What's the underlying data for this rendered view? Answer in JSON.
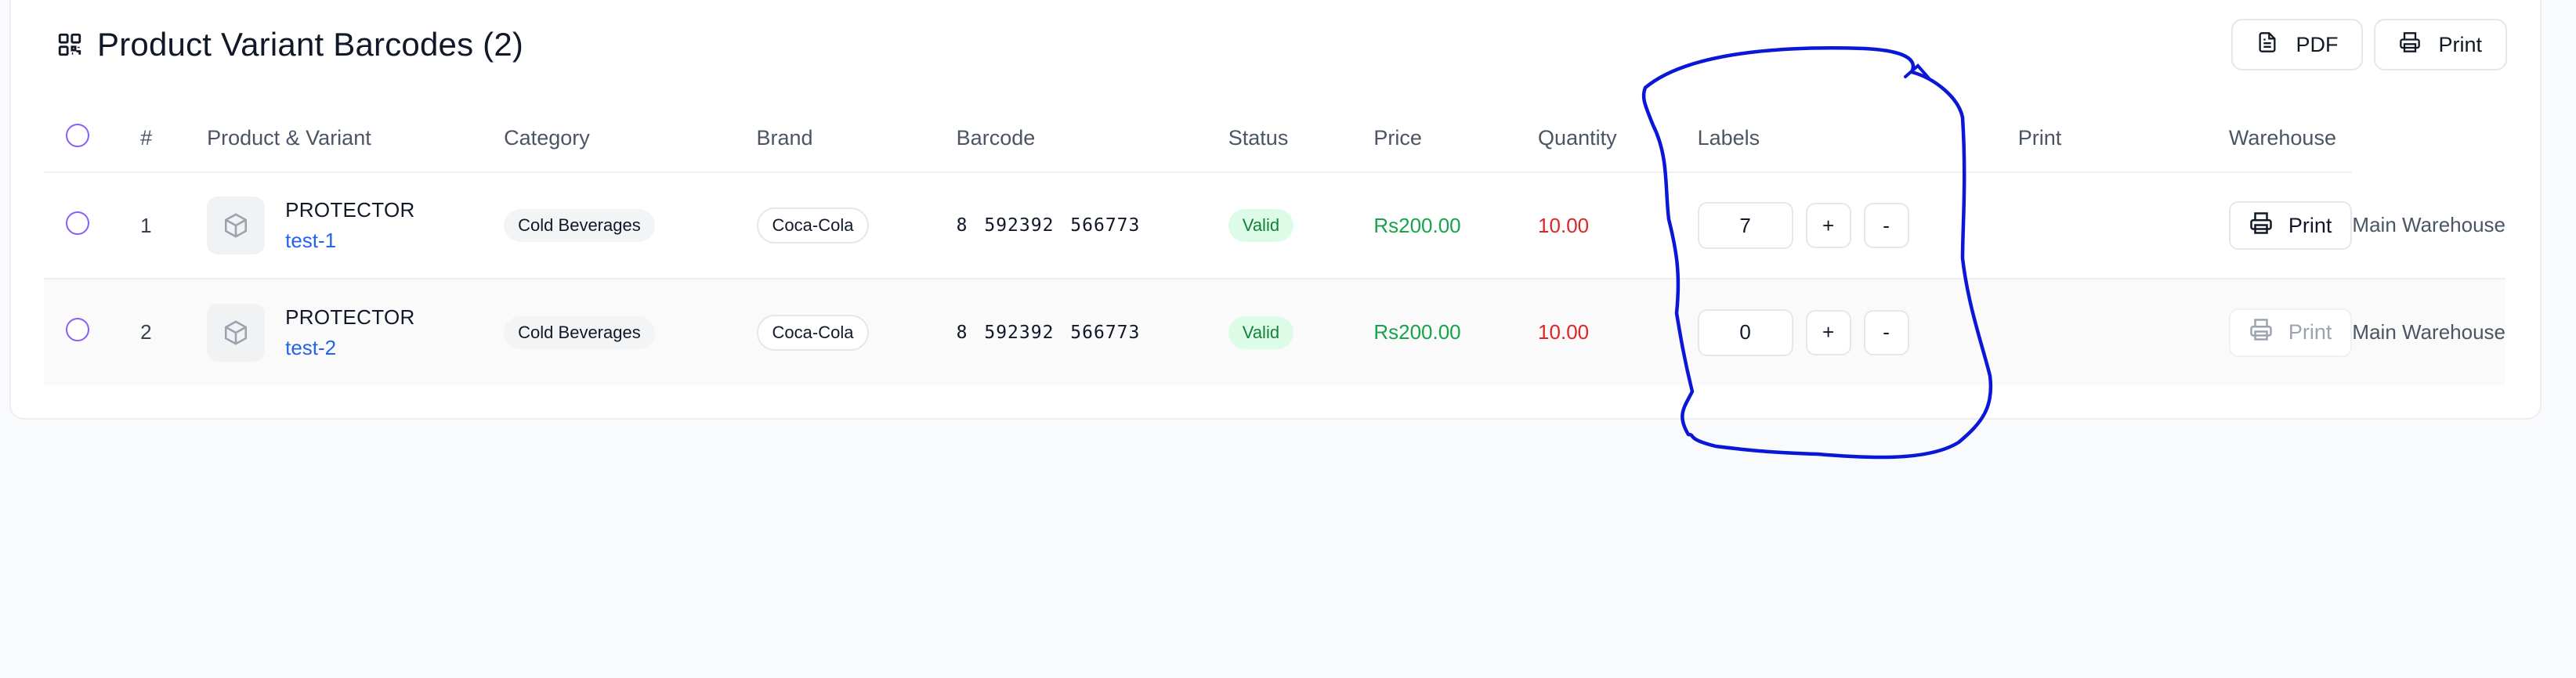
{
  "header": {
    "title": "Product Variant Barcodes (2)",
    "pdf_label": "PDF",
    "print_label": "Print"
  },
  "table": {
    "columns": [
      "#",
      "Product & Variant",
      "Category",
      "Brand",
      "Barcode",
      "Status",
      "Price",
      "Quantity",
      "Labels",
      "Print",
      "Warehouse"
    ],
    "rows": [
      {
        "index": "1",
        "product": "PROTECTOR",
        "variant": "test-1",
        "category": "Cold Beverages",
        "brand": "Coca-Cola",
        "barcode": "8  592392  566773",
        "status": "Valid",
        "price": "Rs200.00",
        "quantity": "10.00",
        "labels": "7",
        "plus": "+",
        "minus": "-",
        "print": "Print",
        "warehouse": "Main Warehouse"
      },
      {
        "index": "2",
        "product": "PROTECTOR",
        "variant": "test-2",
        "category": "Cold Beverages",
        "brand": "Coca-Cola",
        "barcode": "8  592392  566773",
        "status": "Valid",
        "price": "Rs200.00",
        "quantity": "10.00",
        "labels": "0",
        "plus": "+",
        "minus": "-",
        "print": "Print",
        "warehouse": "Main Warehouse"
      }
    ]
  },
  "colors": {
    "accent_purple": "#8b5cf6",
    "variant_blue": "#2563eb",
    "price_green": "#16a34a",
    "quantity_red": "#dc2626",
    "status_bg": "#dcfce7",
    "annotation_stroke": "#0a17d6"
  },
  "icons": {
    "title": "qr-code-icon",
    "pdf": "file-text-icon",
    "print": "printer-icon",
    "thumb": "package-icon"
  }
}
